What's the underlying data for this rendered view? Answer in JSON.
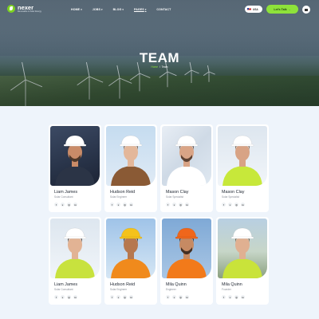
{
  "header": {
    "logo_name": "nexer",
    "logo_tagline": "Renewable & Solar Energy",
    "nav": [
      {
        "label": "HOME",
        "caret": true
      },
      {
        "label": "JOBS",
        "caret": true
      },
      {
        "label": "BLOG",
        "caret": true
      },
      {
        "label": "PAGES",
        "caret": true,
        "active": true
      },
      {
        "label": "CONTACT",
        "caret": false
      }
    ],
    "language": "USA",
    "cta_label": "Let's Talk"
  },
  "hero": {
    "title": "TEAM",
    "breadcrumb_home": "Home",
    "breadcrumb_sep": "/",
    "breadcrumb_current": "Team"
  },
  "team": [
    {
      "name": "Liam James",
      "role": "Solar Consultant",
      "bg": "bg-solar",
      "vest": "#2b3446",
      "helmet": "#ffffff",
      "skin": "#c98b68",
      "hair": "#3a2a20",
      "beard": true,
      "socials": [
        "f",
        "x",
        "◎",
        "in"
      ]
    },
    {
      "name": "Hudson Reid",
      "role": "Solar Engineer",
      "bg": "bg-sky",
      "vest": "#8a5a35",
      "helmet": "#ffffff",
      "skin": "#e3b79a",
      "hair": "#6b4528",
      "beard": false,
      "socials": [
        "f",
        "x",
        "◎",
        "in"
      ]
    },
    {
      "name": "Mason Clay",
      "role": "Solar Specialist",
      "bg": "bg-panels",
      "vest": "#ffffff",
      "helmet": "#ffffff",
      "skin": "#d9a486",
      "hair": "#4a3325",
      "beard": true,
      "socials": [
        "f",
        "x",
        "◎",
        "in"
      ]
    },
    {
      "name": "Mason Clay",
      "role": "Solar Specialist",
      "bg": "bg-cloud",
      "vest": "#c7e83a",
      "helmet": "#ffffff",
      "skin": "#d8a385",
      "hair": "#6b4a30",
      "beard": false,
      "socials": [
        "f",
        "x",
        "◎",
        "in"
      ]
    },
    {
      "name": "Liam James",
      "role": "Solar Consultant",
      "bg": "bg-cloud",
      "vest": "#c8e23e",
      "helmet": "#ffffff",
      "skin": "#e2b394",
      "hair": "#3b2b22",
      "beard": false,
      "socials": [
        "f",
        "x",
        "◎",
        "in"
      ]
    },
    {
      "name": "Hudson Reid",
      "role": "Solar Engineer",
      "bg": "bg-sky2",
      "vest": "#f08a1c",
      "helmet": "#f4c21b",
      "skin": "#b6784f",
      "hair": "#2a1d15",
      "beard": false,
      "socials": [
        "f",
        "x",
        "◎",
        "in"
      ]
    },
    {
      "name": "Mila Quinn",
      "role": "Engineer",
      "bg": "bg-blue",
      "vest": "#f27a1a",
      "helmet": "#f0661b",
      "skin": "#c68a63",
      "hair": "#2c1f18",
      "beard": true,
      "socials": [
        "f",
        "x",
        "◎",
        "in"
      ]
    },
    {
      "name": "Mila Quinn",
      "role": "Founder",
      "bg": "bg-outdoor",
      "vest": "#c9e33a",
      "helmet": "#ffffff",
      "skin": "#e0b091",
      "hair": "#6a4a33",
      "beard": false,
      "socials": [
        "f",
        "x",
        "◎",
        "in"
      ]
    }
  ],
  "colors": {
    "accent": "#8ee23a",
    "page_bg": "#eef4fb",
    "text_dark": "#1d2430",
    "text_muted": "#8a8f98"
  }
}
